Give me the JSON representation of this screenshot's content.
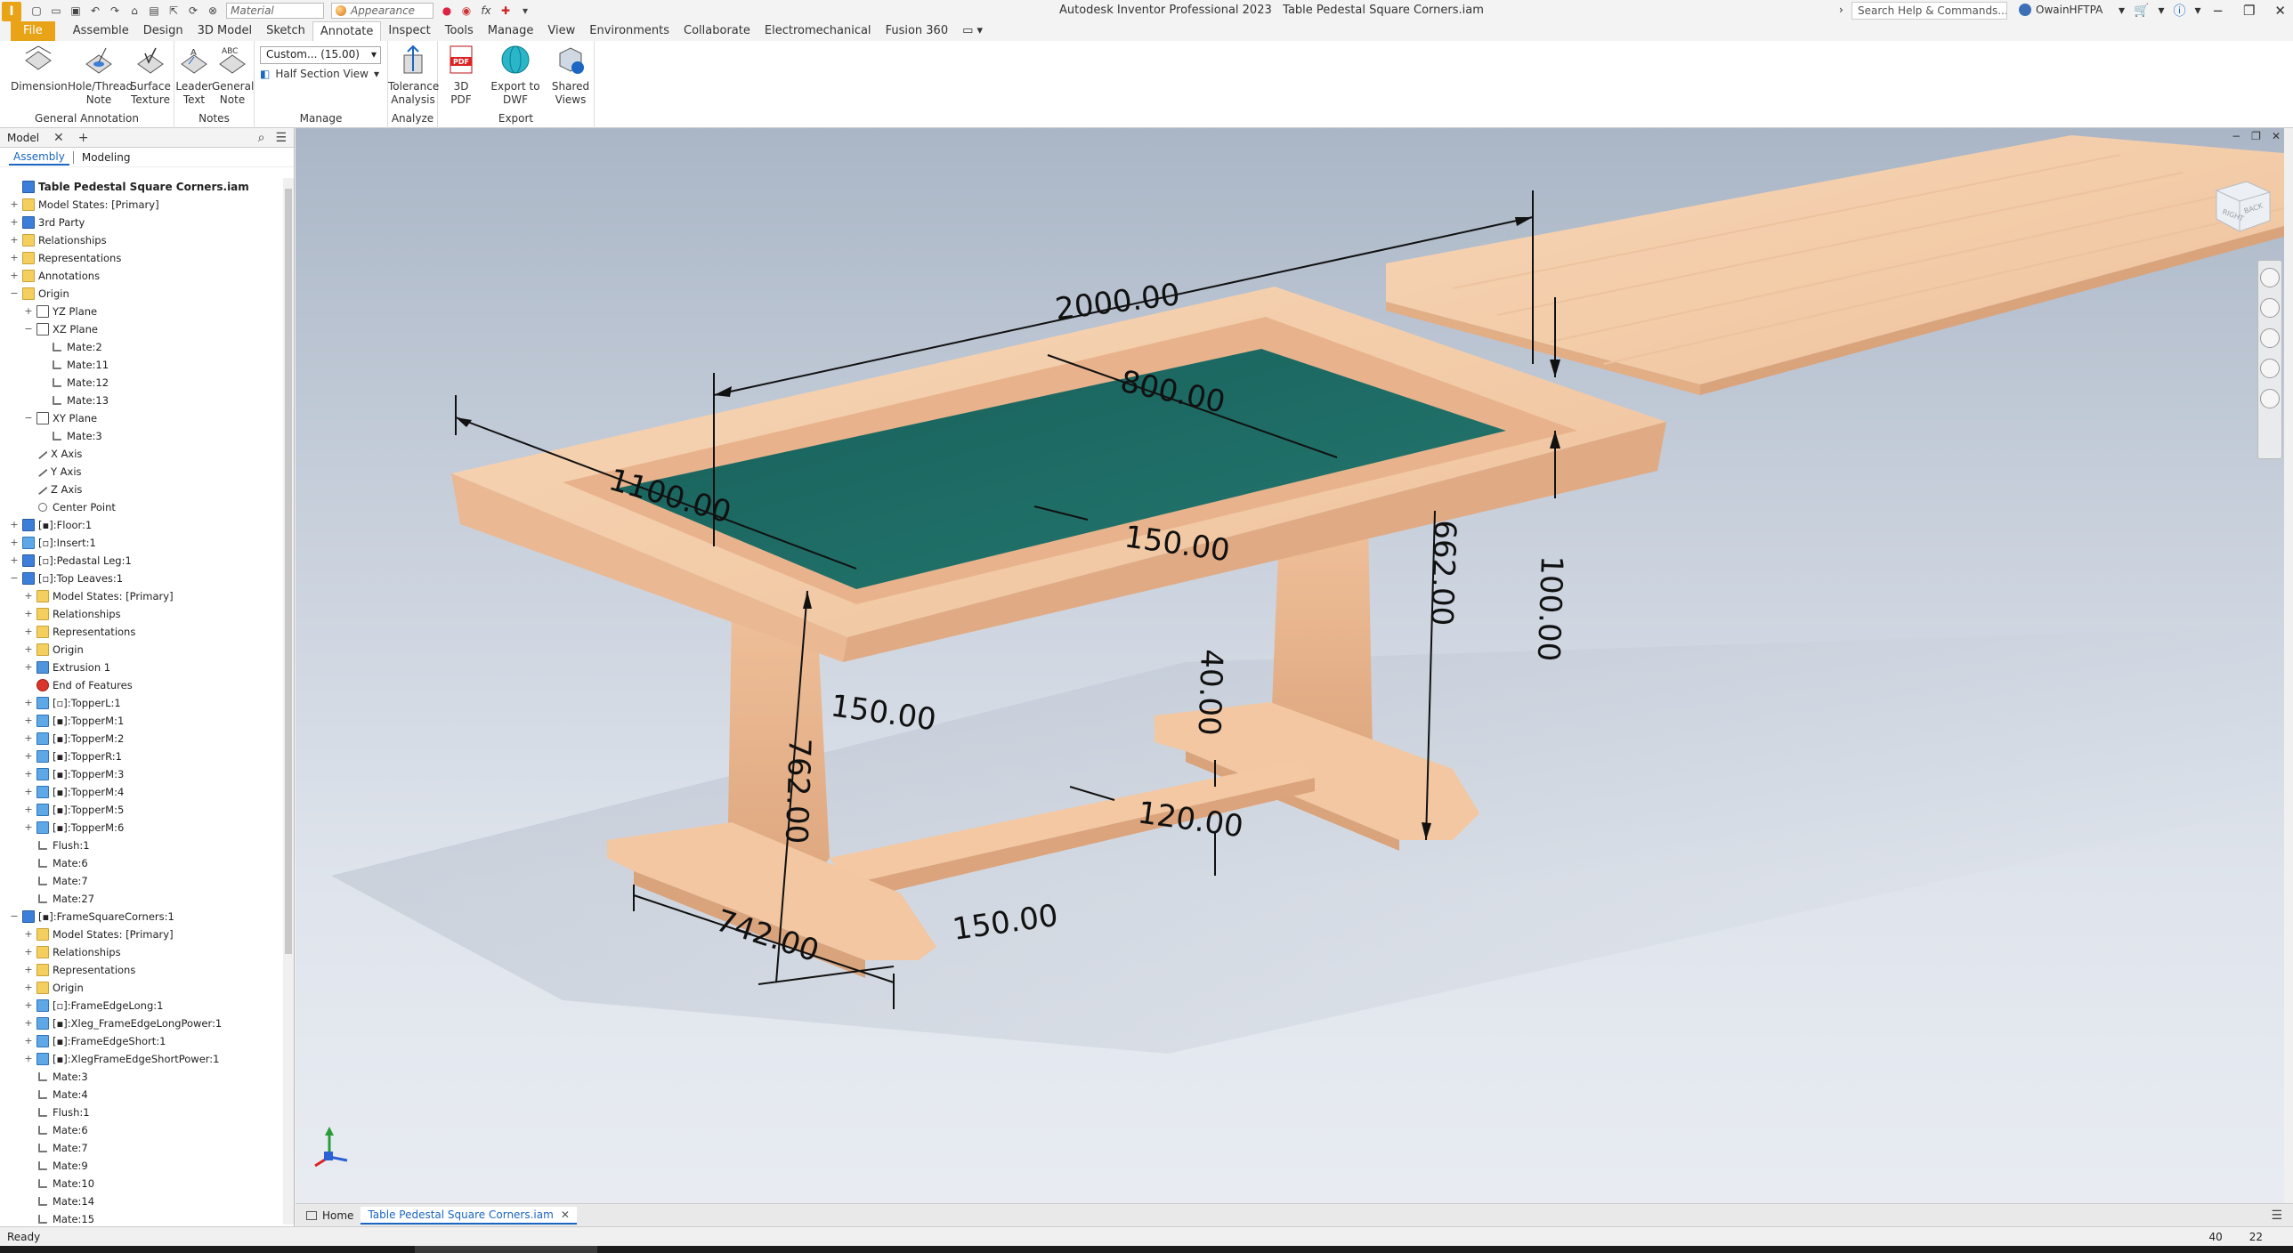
{
  "title_bar": {
    "app_title": "Autodesk Inventor Professional 2023",
    "document_title": "Table Pedestal Square Corners.iam",
    "material_combo": "Material",
    "appearance_combo": "Appearance",
    "search_placeholder": "Search Help & Commands...",
    "user_name": "OwainHFTPA"
  },
  "ribbon_tabs": [
    "File",
    "Assemble",
    "Design",
    "3D Model",
    "Sketch",
    "Annotate",
    "Inspect",
    "Tools",
    "Manage",
    "View",
    "Environments",
    "Collaborate",
    "Electromechanical",
    "Fusion 360"
  ],
  "ribbon_active_tab": "Annotate",
  "ribbon": {
    "general_annotation": {
      "label": "General Annotation",
      "dimension": "Dimension",
      "hole_thread_note_1": "Hole/Thread",
      "hole_thread_note_2": "Note",
      "surface_texture_1": "Surface",
      "surface_texture_2": "Texture"
    },
    "notes": {
      "label": "Notes",
      "leader_text_1": "Leader",
      "leader_text_2": "Text",
      "general_note_1": "General",
      "general_note_2": "Note"
    },
    "manage": {
      "label": "Manage",
      "scale_combo": "Custom... (15.00)",
      "half_section_view": "Half Section View"
    },
    "analyze": {
      "label": "Analyze",
      "tolerance_analysis_1": "Tolerance",
      "tolerance_analysis_2": "Analysis"
    },
    "export": {
      "label": "Export",
      "pdf_3d": "3D PDF",
      "export_dwf": "Export to DWF",
      "shared_views_1": "Shared",
      "shared_views_2": "Views"
    }
  },
  "browser": {
    "tab_label": "Model",
    "subtab_assembly": "Assembly",
    "subtab_modeling": "Modeling",
    "tree": [
      {
        "label": "Table Pedestal Square Corners.iam",
        "level": 0,
        "exp": "",
        "icon": "asm",
        "root": true
      },
      {
        "label": "Model States: [Primary]",
        "level": 0,
        "exp": "+",
        "icon": "folder"
      },
      {
        "label": "3rd Party",
        "level": 0,
        "exp": "+",
        "icon": "asm"
      },
      {
        "label": "Relationships",
        "level": 0,
        "exp": "+",
        "icon": "folder"
      },
      {
        "label": "Representations",
        "level": 0,
        "exp": "+",
        "icon": "rep"
      },
      {
        "label": "Annotations",
        "level": 0,
        "exp": "+",
        "icon": "folder"
      },
      {
        "label": "Origin",
        "level": 0,
        "exp": "−",
        "icon": "folder"
      },
      {
        "label": "YZ Plane",
        "level": 1,
        "exp": "+",
        "icon": "plane"
      },
      {
        "label": "XZ Plane",
        "level": 1,
        "exp": "−",
        "icon": "plane"
      },
      {
        "label": "Mate:2",
        "level": 2,
        "exp": "",
        "icon": "mate"
      },
      {
        "label": "Mate:11",
        "level": 2,
        "exp": "",
        "icon": "mate"
      },
      {
        "label": "Mate:12",
        "level": 2,
        "exp": "",
        "icon": "mate"
      },
      {
        "label": "Mate:13",
        "level": 2,
        "exp": "",
        "icon": "mate"
      },
      {
        "label": "XY Plane",
        "level": 1,
        "exp": "−",
        "icon": "plane"
      },
      {
        "label": "Mate:3",
        "level": 2,
        "exp": "",
        "icon": "mate"
      },
      {
        "label": "X Axis",
        "level": 1,
        "exp": "",
        "icon": "axis"
      },
      {
        "label": "Y Axis",
        "level": 1,
        "exp": "",
        "icon": "axis"
      },
      {
        "label": "Z Axis",
        "level": 1,
        "exp": "",
        "icon": "axis"
      },
      {
        "label": "Center Point",
        "level": 1,
        "exp": "",
        "icon": "point"
      },
      {
        "label": "[▪]:Floor:1",
        "level": 0,
        "exp": "+",
        "icon": "asm"
      },
      {
        "label": "[▫]:Insert:1",
        "level": 0,
        "exp": "+",
        "icon": "part"
      },
      {
        "label": "[▫]:Pedastal Leg:1",
        "level": 0,
        "exp": "+",
        "icon": "asm"
      },
      {
        "label": "[▫]:Top Leaves:1",
        "level": 0,
        "exp": "−",
        "icon": "asm"
      },
      {
        "label": "Model States: [Primary]",
        "level": 1,
        "exp": "+",
        "icon": "folder"
      },
      {
        "label": "Relationships",
        "level": 1,
        "exp": "+",
        "icon": "folder"
      },
      {
        "label": "Representations",
        "level": 1,
        "exp": "+",
        "icon": "rep"
      },
      {
        "label": "Origin",
        "level": 1,
        "exp": "+",
        "icon": "folder"
      },
      {
        "label": "Extrusion 1",
        "level": 1,
        "exp": "+",
        "icon": "extr"
      },
      {
        "label": "End of Features",
        "level": 1,
        "exp": "",
        "icon": "eof"
      },
      {
        "label": "[▫]:TopperL:1",
        "level": 1,
        "exp": "+",
        "icon": "part"
      },
      {
        "label": "[▪]:TopperM:1",
        "level": 1,
        "exp": "+",
        "icon": "part"
      },
      {
        "label": "[▪]:TopperM:2",
        "level": 1,
        "exp": "+",
        "icon": "part"
      },
      {
        "label": "[▪]:TopperR:1",
        "level": 1,
        "exp": "+",
        "icon": "part"
      },
      {
        "label": "[▪]:TopperM:3",
        "level": 1,
        "exp": "+",
        "icon": "part"
      },
      {
        "label": "[▪]:TopperM:4",
        "level": 1,
        "exp": "+",
        "icon": "part"
      },
      {
        "label": "[▪]:TopperM:5",
        "level": 1,
        "exp": "+",
        "icon": "part"
      },
      {
        "label": "[▪]:TopperM:6",
        "level": 1,
        "exp": "+",
        "icon": "part"
      },
      {
        "label": "Flush:1",
        "level": 1,
        "exp": "",
        "icon": "mate"
      },
      {
        "label": "Mate:6",
        "level": 1,
        "exp": "",
        "icon": "mate"
      },
      {
        "label": "Mate:7",
        "level": 1,
        "exp": "",
        "icon": "mate"
      },
      {
        "label": "Mate:27",
        "level": 1,
        "exp": "",
        "icon": "mate"
      },
      {
        "label": "[▪]:FrameSquareCorners:1",
        "level": 0,
        "exp": "−",
        "icon": "asm"
      },
      {
        "label": "Model States: [Primary]",
        "level": 1,
        "exp": "+",
        "icon": "folder"
      },
      {
        "label": "Relationships",
        "level": 1,
        "exp": "+",
        "icon": "folder"
      },
      {
        "label": "Representations",
        "level": 1,
        "exp": "+",
        "icon": "rep"
      },
      {
        "label": "Origin",
        "level": 1,
        "exp": "+",
        "icon": "folder"
      },
      {
        "label": "[▫]:FrameEdgeLong:1",
        "level": 1,
        "exp": "+",
        "icon": "part"
      },
      {
        "label": "[▪]:Xleg_FrameEdgeLongPower:1",
        "level": 1,
        "exp": "+",
        "icon": "part"
      },
      {
        "label": "[▪]:FrameEdgeShort:1",
        "level": 1,
        "exp": "+",
        "icon": "part"
      },
      {
        "label": "[▪]:XlegFrameEdgeShortPower:1",
        "level": 1,
        "exp": "+",
        "icon": "part"
      },
      {
        "label": "Mate:3",
        "level": 1,
        "exp": "",
        "icon": "mate"
      },
      {
        "label": "Mate:4",
        "level": 1,
        "exp": "",
        "icon": "mate"
      },
      {
        "label": "Flush:1",
        "level": 1,
        "exp": "",
        "icon": "mate"
      },
      {
        "label": "Mate:6",
        "level": 1,
        "exp": "",
        "icon": "mate"
      },
      {
        "label": "Mate:7",
        "level": 1,
        "exp": "",
        "icon": "mate"
      },
      {
        "label": "Mate:9",
        "level": 1,
        "exp": "",
        "icon": "mate"
      },
      {
        "label": "Mate:10",
        "level": 1,
        "exp": "",
        "icon": "mate"
      },
      {
        "label": "Mate:14",
        "level": 1,
        "exp": "",
        "icon": "mate"
      },
      {
        "label": "Mate:15",
        "level": 1,
        "exp": "",
        "icon": "mate"
      }
    ]
  },
  "viewcube": {
    "right_label": "RIGHT",
    "back_label": "BACK"
  },
  "dimensions": {
    "d2000": "2000.00",
    "d800": "800.00",
    "d1100": "1100.00",
    "d150_top": "150.00",
    "d662": "662.00",
    "d100": "100.00",
    "d40": "40.00",
    "d150_leg": "150.00",
    "d762": "762.00",
    "d120": "120.00",
    "d742": "742.00",
    "d150_foot": "150.00"
  },
  "doc_tabs": {
    "home": "Home",
    "active": "Table Pedestal Square Corners.iam"
  },
  "status": {
    "text": "Ready",
    "count1": "40",
    "count2": "22"
  },
  "colors": {
    "accent": "#e8a317",
    "wood": "#f3c9a4",
    "felt": "#1f6b64",
    "select_blue": "#1a66c2"
  }
}
